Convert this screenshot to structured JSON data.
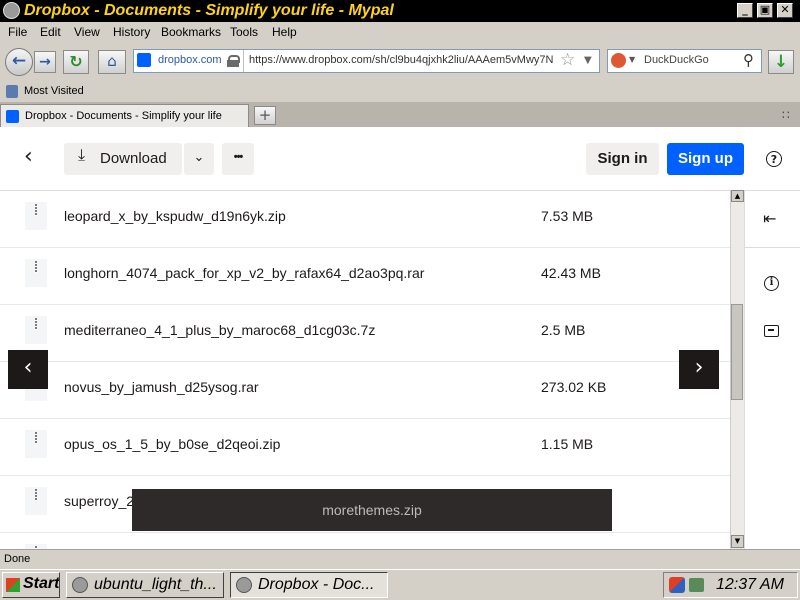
{
  "window": {
    "title": "Dropbox - Documents - Simplify your life - Mypal"
  },
  "menu": [
    "File",
    "Edit",
    "View",
    "History",
    "Bookmarks",
    "Tools",
    "Help"
  ],
  "navbar": {
    "site_identity": "dropbox.com",
    "url": "https://www.dropbox.com/sh/cl9bu4qjxhk2liu/AAAem5vMwy7N",
    "search_engine": "DuckDuckGo"
  },
  "bookmarks": {
    "most_visited": "Most Visited"
  },
  "tab": {
    "title": "Dropbox - Documents - Simplify your life"
  },
  "toolbar": {
    "download_label": "Download",
    "more_label": "•••",
    "sign_in_label": "Sign in",
    "sign_up_label": "Sign up",
    "help_label": "?"
  },
  "files": [
    {
      "name": "leopard_x_by_kspudw_d19n6yk.zip",
      "size": "7.53 MB"
    },
    {
      "name": "longhorn_4074_pack_for_xp_v2_by_rafax64_d2ao3pq.rar",
      "size": "42.43 MB"
    },
    {
      "name": "mediterraneo_4_1_plus_by_maroc68_d1cg03c.7z",
      "size": "2.5 MB"
    },
    {
      "name": "novus_by_jamush_d25ysog.rar",
      "size": "273.02 KB"
    },
    {
      "name": "opus_os_1_5_by_b0se_d2qeoi.zip",
      "size": "1.15 MB"
    },
    {
      "name": "superroy_2",
      "size": ""
    }
  ],
  "tooltip": {
    "text": "morethemes.zip"
  },
  "status": {
    "text": "Done"
  },
  "taskbar": {
    "start_label": "Start",
    "tasks": [
      {
        "label": "ubuntu_light_th..."
      },
      {
        "label": "Dropbox - Doc..."
      }
    ],
    "clock": "12:37 AM"
  },
  "colors": {
    "accent": "#0061fe",
    "title_bg": "#000000",
    "title_text": "#ffd21a"
  }
}
